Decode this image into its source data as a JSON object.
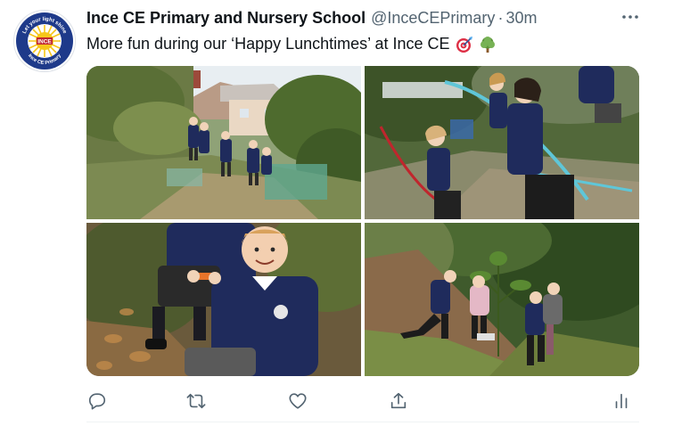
{
  "author": {
    "display_name": "Ince CE Primary and Nursery School",
    "handle": "@InceCEPrimary",
    "separator": "·",
    "timestamp": "30m",
    "avatar": {
      "top_text": "Let your light shine",
      "center_text": "INCE",
      "bottom_text": "Ince CE Primary",
      "ring_color": "#1e3a8a",
      "sun_color": "#f6c619"
    }
  },
  "tweet": {
    "text": "More fun during our ‘Happy Lunchtimes’ at Ince CE",
    "emojis": [
      "direct-hit-icon",
      "tree-icon"
    ]
  },
  "media": {
    "photos": [
      {
        "name": "photo-garden-children"
      },
      {
        "name": "photo-archery-bows"
      },
      {
        "name": "photo-boy-smiling"
      },
      {
        "name": "photo-woodland-planting"
      }
    ]
  },
  "actions": [
    {
      "name": "reply-icon"
    },
    {
      "name": "retweet-icon"
    },
    {
      "name": "like-icon"
    },
    {
      "name": "share-icon"
    },
    {
      "name": "analytics-icon"
    }
  ],
  "colors": {
    "text_primary": "#0f1419",
    "text_secondary": "#536471",
    "uniform_navy": "#1f2b5c"
  }
}
